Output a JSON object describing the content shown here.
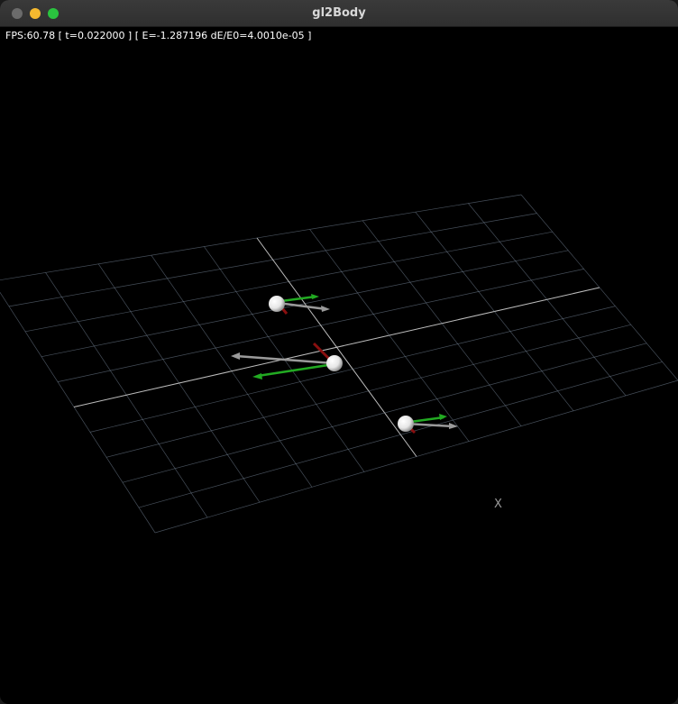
{
  "window": {
    "title": "gl2Body"
  },
  "hud": {
    "fps": "60.78",
    "time": "0.022000",
    "energy": "-1.287196",
    "energy_error": "4.0010e-05",
    "text": "FPS:60.78 [ t=0.022000 ] [ E=-1.287196 dE/E0=4.0010e-05 ]"
  },
  "scene": {
    "axis_label_x": "X",
    "bodies_count": 3,
    "colors": {
      "grid": "#7f8fa3",
      "axis": "#c8c8c8",
      "velocity_arrow": "#22aa22",
      "force_arrow": "#9a9a9a",
      "accel_arrow": "#8a1010",
      "body": "#ffffff"
    }
  }
}
